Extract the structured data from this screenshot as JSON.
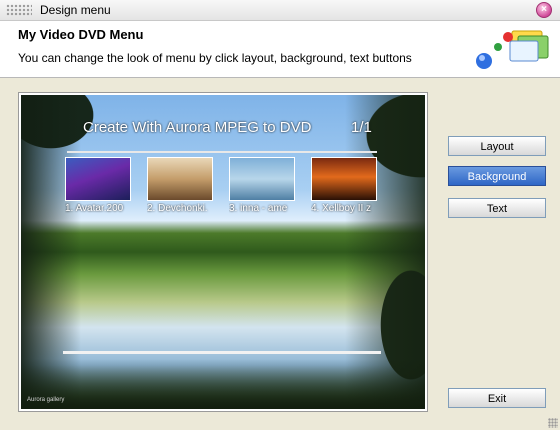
{
  "window": {
    "title": "Design menu"
  },
  "header": {
    "title": "My Video DVD Menu",
    "subtitle": "You can change the look of menu by click layout, background, text buttons"
  },
  "preview": {
    "menu_title": "Create With Aurora MPEG to DVD",
    "page_indicator": "1/1",
    "watermark": "Aurora gallery",
    "thumbnails": [
      {
        "caption": "1. Avatar.200",
        "color": "#4a3ab0"
      },
      {
        "caption": "2. Devchonki.",
        "color": "#c49d6a"
      },
      {
        "caption": "3. inna - ame",
        "color": "#7fb0d8"
      },
      {
        "caption": "4. Xellboy II z",
        "color": "#e26a1c"
      }
    ]
  },
  "buttons": {
    "layout": "Layout",
    "background": "Background",
    "text": "Text",
    "exit": "Exit"
  },
  "colors": {
    "accent": "#2e66c6",
    "frame": "#ece9d8"
  }
}
